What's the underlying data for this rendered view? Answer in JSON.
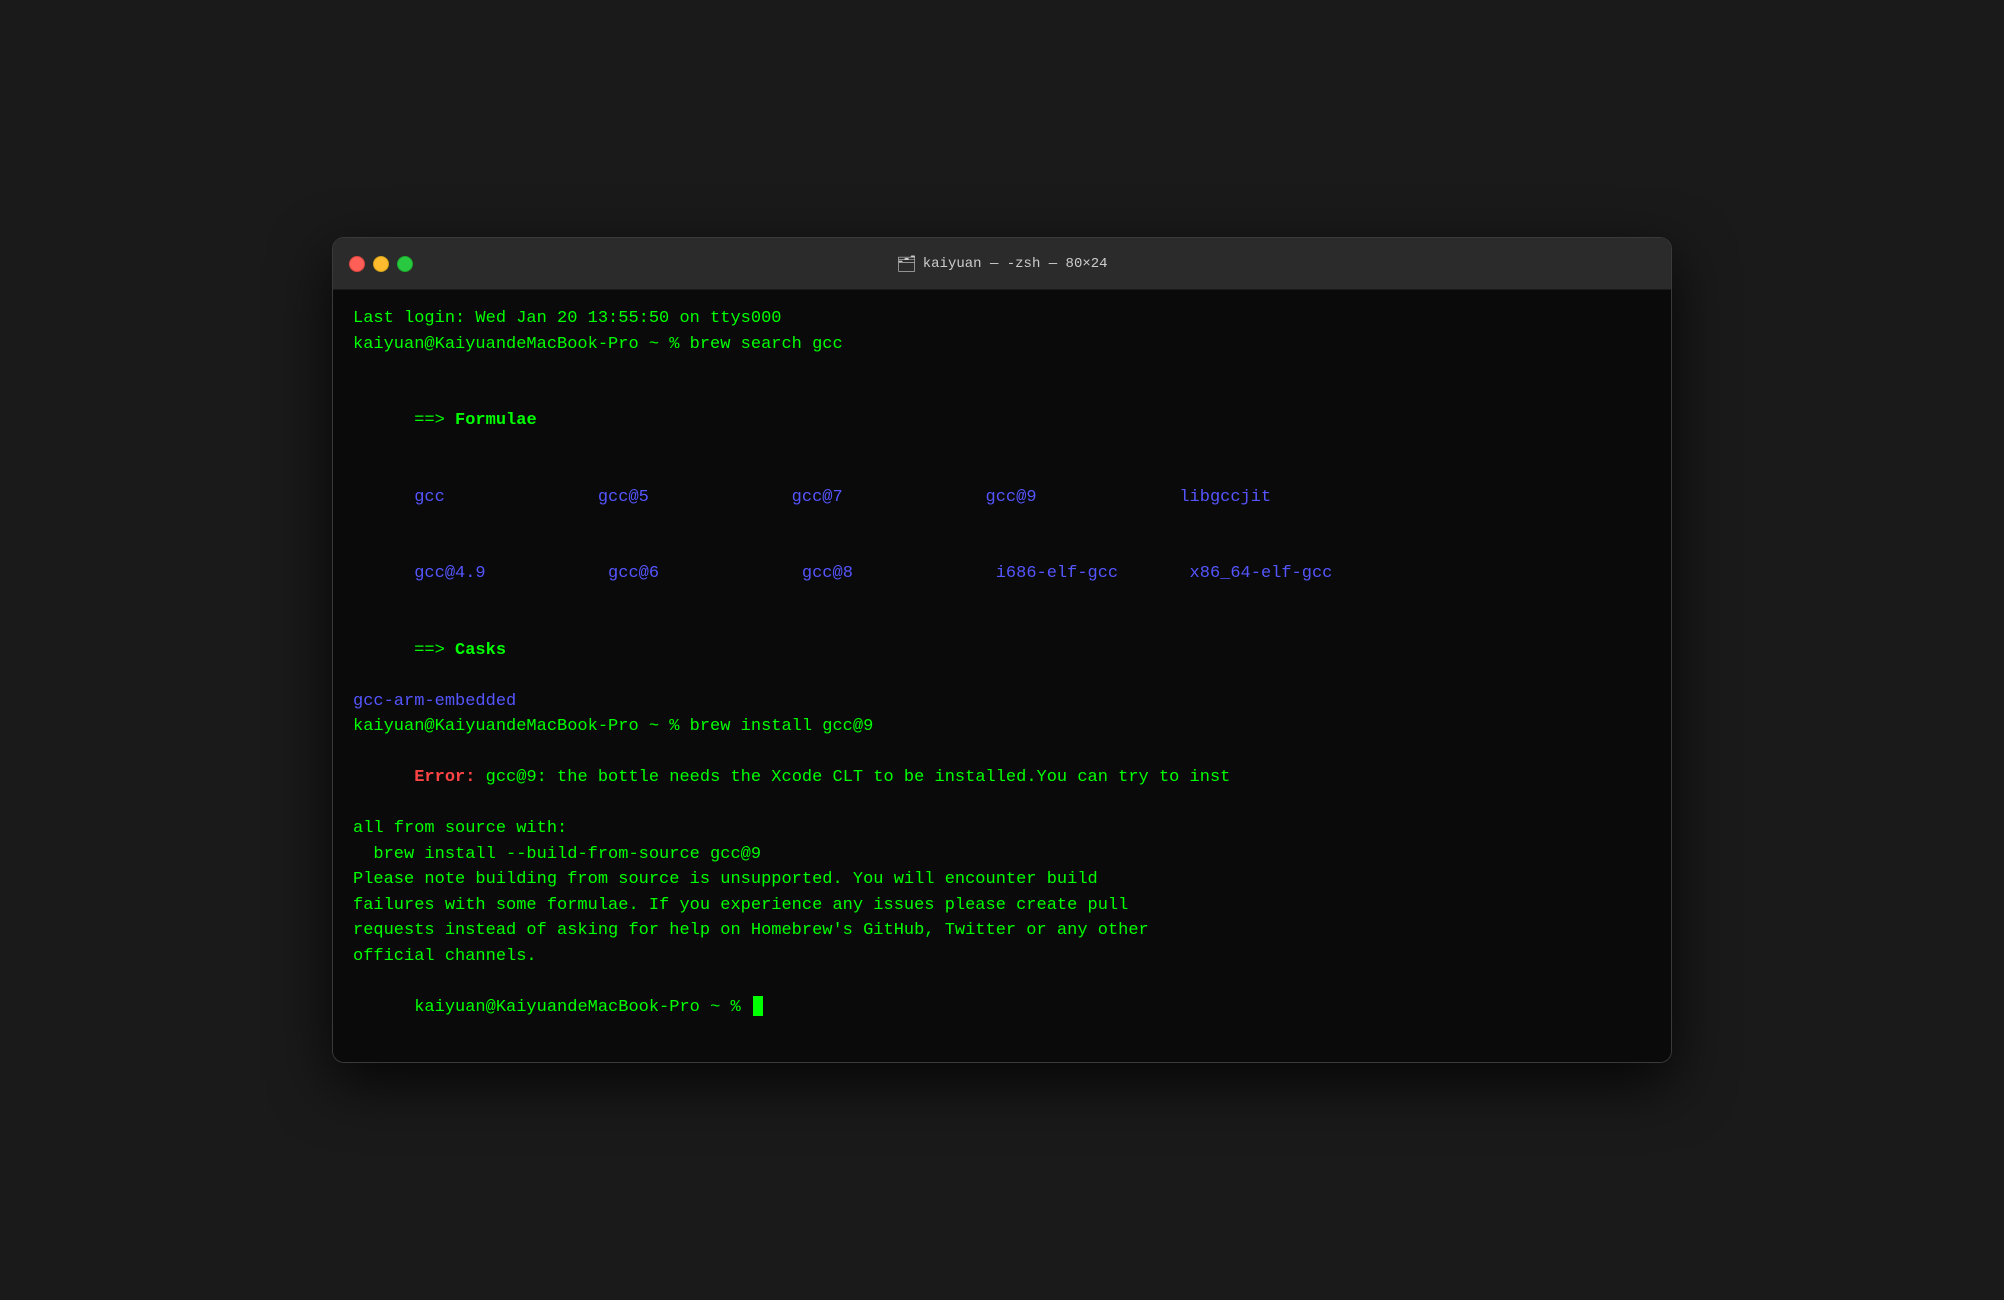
{
  "window": {
    "title": "kaiyuan — -zsh — 80×24",
    "folder_icon": "🗂"
  },
  "traffic_lights": {
    "close": "close",
    "minimize": "minimize",
    "maximize": "maximize"
  },
  "terminal": {
    "lines": [
      {
        "type": "green",
        "text": "Last login: Wed Jan 20 13:55:50 on ttys000"
      },
      {
        "type": "prompt",
        "text": "kaiyuan@KaiyuandeMacBook-Pro ~ % brew search gcc"
      },
      {
        "type": "empty"
      },
      {
        "type": "formulae-header",
        "arrow": "==>",
        "label": "Formulae"
      },
      {
        "type": "formula-row",
        "cols": [
          "gcc",
          "gcc@5",
          "gcc@7",
          "gcc@9",
          "libgccjit"
        ]
      },
      {
        "type": "formula-row",
        "cols": [
          "gcc@4.9",
          "gcc@6",
          "gcc@8",
          "i686-elf-gcc",
          "x86_64-elf-gcc"
        ]
      },
      {
        "type": "casks-header",
        "arrow": "==>",
        "label": "Casks"
      },
      {
        "type": "cask-item",
        "text": "gcc-arm-embedded"
      },
      {
        "type": "prompt",
        "text": "kaiyuan@KaiyuandeMacBook-Pro ~ % brew install gcc@9"
      },
      {
        "type": "error-line",
        "error_label": "Error:",
        "error_text": " gcc@9: the bottle needs the Xcode CLT to be installed.You can try to inst"
      },
      {
        "type": "green",
        "text": "all from source with:"
      },
      {
        "type": "green",
        "text": "  brew install --build-from-source gcc@9"
      },
      {
        "type": "warning",
        "text": "Please note building from source is unsupported. You will encounter build"
      },
      {
        "type": "warning",
        "text": "failures with some formulae. If you experience any issues please create pull"
      },
      {
        "type": "warning",
        "text": "requests instead of asking for help on Homebrew's GitHub, Twitter or any other"
      },
      {
        "type": "warning",
        "text": "official channels."
      },
      {
        "type": "prompt-cursor",
        "text": "kaiyuan@KaiyuandeMacBook-Pro ~ % "
      }
    ]
  }
}
